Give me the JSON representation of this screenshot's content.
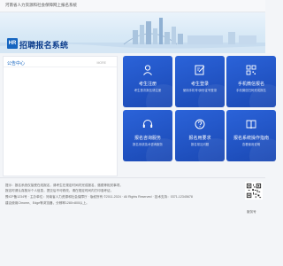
{
  "topbar": {
    "text": "河南省人力资源和社会保障网上报名系统"
  },
  "header": {
    "logo": "HR",
    "title": "招聘报名系统"
  },
  "notice": {
    "title": "公告中心",
    "more": "MORE"
  },
  "tiles": [
    {
      "title": "考生注册",
      "desc": "考生首次报名请注册",
      "icon": "user-register-icon"
    },
    {
      "title": "考生登录",
      "desc": "使用手机号/身份证号登录",
      "icon": "login-edit-icon"
    },
    {
      "title": "手机微信报名",
      "desc": "手机微信扫码完成报名",
      "icon": "qrcode-icon"
    },
    {
      "title": "报名咨询服务",
      "desc": "报名系统技术咨询服务",
      "icon": "headset-icon"
    },
    {
      "title": "报名用要求",
      "desc": "报名常见问题",
      "icon": "help-icon"
    },
    {
      "title": "报名系统操作指南",
      "desc": "查看使用说明",
      "icon": "book-icon"
    }
  ],
  "footer": {
    "line1": "提示：报名系统仅接受在线报名，请考生在规定时间内完成报名、缴费等相关事项。",
    "line2": "报名时请认真核对个人信息，提交后不可修改，请在规定时间内打印准考证。",
    "line3": "豫ICP备1234号 · 主办单位：河南省人力资源和社会保障厅 · 版权所有 ©2011-2024 · All Rights Reserved · 技术支持：0371-12345678",
    "line4": "建议使用Chrome、Edge等浏览器，分辨率1280×800以上。",
    "qr_label": "服务号"
  },
  "colors": {
    "tile": "#1f55c6",
    "accent": "#1565c0",
    "title": "#0b3c8c"
  }
}
